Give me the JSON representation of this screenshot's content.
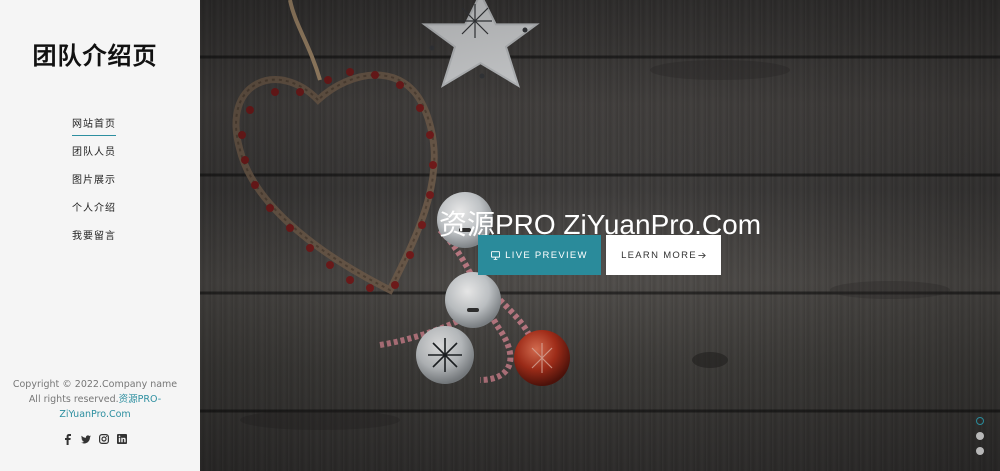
{
  "sidebar": {
    "brand": "团队介绍页",
    "nav": [
      {
        "label": "网站首页",
        "active": true
      },
      {
        "label": "团队人员",
        "active": false
      },
      {
        "label": "图片展示",
        "active": false
      },
      {
        "label": "个人介绍",
        "active": false
      },
      {
        "label": "我要留言",
        "active": false
      }
    ],
    "copyright_text": "Copyright © 2022.Company name All rights reserved.",
    "copyright_link": "资源PRO-ZiYuanPro.Com",
    "social": [
      {
        "icon": "facebook-icon"
      },
      {
        "icon": "twitter-icon"
      },
      {
        "icon": "instagram-icon"
      },
      {
        "icon": "linkedin-icon"
      }
    ]
  },
  "hero": {
    "title": "资源PRO ZiYuanPro.Com",
    "preview_label": "LIVE PREVIEW",
    "preview_icon": "monitor-icon",
    "learn_label": "LEARN MORE",
    "learn_icon": "arrow-right-icon",
    "slides": [
      {
        "active": true
      },
      {
        "active": false
      },
      {
        "active": false
      }
    ]
  },
  "colors": {
    "accent": "#2a8b9b",
    "sidebar_bg": "#f5f5f5",
    "brand_text": "#111111"
  }
}
